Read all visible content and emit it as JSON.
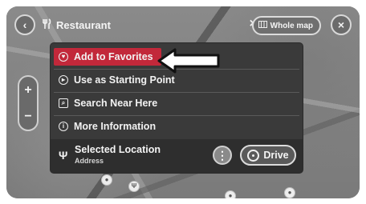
{
  "search": {
    "back_glyph": "‹",
    "query": "Restaurant",
    "category_icon": "fork-knife-icon",
    "clear_glyph": "×",
    "whole_map_label": "Whole map",
    "close_glyph": "×"
  },
  "zoom": {
    "in": "+",
    "out": "−"
  },
  "menu": {
    "items": [
      {
        "label": "Add to Favorites",
        "icon": "heart-icon",
        "highlighted": true
      },
      {
        "label": "Use as Starting Point",
        "icon": "start-point-icon",
        "highlighted": false
      },
      {
        "label": "Search Near Here",
        "icon": "search-near-icon",
        "highlighted": false
      },
      {
        "label": "More Information",
        "icon": "info-icon",
        "highlighted": false
      }
    ],
    "selected": {
      "title": "Selected Location",
      "subtitle": "Address",
      "more_glyph": "⋮",
      "drive_label": "Drive"
    }
  },
  "colors": {
    "highlight": "#c2283a",
    "menu_bg": "#3a3a3a"
  }
}
